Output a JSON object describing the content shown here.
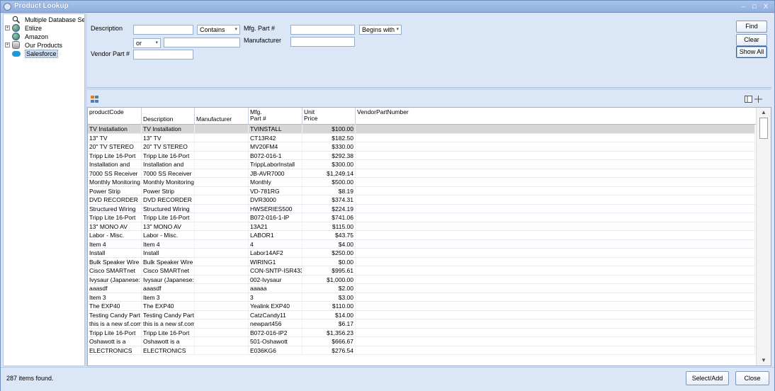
{
  "window": {
    "title": "Product Lookup",
    "minimize": "–",
    "maximize": "□",
    "close": "X"
  },
  "tree": {
    "items": [
      {
        "label": "Multiple Database Search",
        "expander": "",
        "icon": "search-icon",
        "selected": false
      },
      {
        "label": "Etilize",
        "expander": "+",
        "icon": "database-globe-icon",
        "selected": false
      },
      {
        "label": "Amazon",
        "expander": "",
        "icon": "database-globe-icon",
        "selected": false
      },
      {
        "label": "Our Products",
        "expander": "+",
        "icon": "database-icon",
        "selected": false
      },
      {
        "label": "Salesforce",
        "expander": "",
        "icon": "salesforce-cloud-icon",
        "selected": true
      }
    ]
  },
  "search": {
    "description_label": "Description",
    "description_value": "",
    "description_mode": "Contains",
    "logic_operator": "or",
    "description2_value": "",
    "mfg_part_label": "Mfg. Part #",
    "mfg_part_value": "",
    "mfg_part_mode": "Begins with",
    "manufacturer_label": "Manufacturer",
    "manufacturer_value": "",
    "vendor_part_label": "Vendor Part #",
    "vendor_part_value": "",
    "find_button": "Find",
    "clear_button": "Clear",
    "show_all_button": "Show All"
  },
  "grid": {
    "columns": {
      "productCode": "productCode",
      "description": "Description",
      "manufacturer": "Manufacturer",
      "mfg_part_1": "Mfg.",
      "mfg_part_2": "Part #",
      "unit_price_1": "Unit",
      "unit_price_2": "Price",
      "vendor": "VendorPartNumber"
    },
    "rows": [
      [
        "TV Installation",
        "TV Installation",
        "",
        "TVINSTALL",
        "$100.00",
        ""
      ],
      [
        "13\" TV",
        "13\" TV",
        "",
        "CT13R42",
        "$182.50",
        ""
      ],
      [
        "20\" TV STEREO",
        "20\" TV STEREO",
        "",
        "MV20FM4",
        "$330.00",
        ""
      ],
      [
        "Tripp Lite 16-Port",
        "Tripp Lite 16-Port",
        "",
        "B072-016-1",
        "$292.38",
        ""
      ],
      [
        "Installation and",
        "Installation and",
        "",
        "TrippLaborInstall",
        "$300.00",
        ""
      ],
      [
        "7000 SS Receiver",
        "7000 SS Receiver",
        "",
        "JB-AVR7000",
        "$1,249.14",
        ""
      ],
      [
        "Monthly Monitoring",
        "Monthly Monitoring",
        "",
        "Monthly",
        "$500.00",
        ""
      ],
      [
        "Power Strip",
        "Power Strip",
        "",
        "VD-781RG",
        "$8.19",
        ""
      ],
      [
        "DVD RECORDER",
        "DVD RECORDER",
        "",
        "DVR3000",
        "$374.31",
        ""
      ],
      [
        "Structured Wiring",
        "Structured Wiring",
        "",
        "HWSERIES500",
        "$224.19",
        ""
      ],
      [
        "Tripp Lite 16-Port",
        "Tripp Lite 16-Port",
        "",
        "B072-016-1-IP",
        "$741.06",
        ""
      ],
      [
        "13\" MONO AV",
        "13\" MONO AV",
        "",
        "13A21",
        "$115.00",
        ""
      ],
      [
        "Labor - Misc.",
        "Labor - Misc.",
        "",
        "LABOR1",
        "$43.75",
        ""
      ],
      [
        "Item 4",
        "Item 4",
        "",
        "4",
        "$4.00",
        ""
      ],
      [
        "Install",
        "Install",
        "",
        "Labor14AF2",
        "$250.00",
        ""
      ],
      [
        "Bulk Speaker Wire -",
        "Bulk Speaker Wire -",
        "",
        "WIRING1",
        "$0.00",
        ""
      ],
      [
        "Cisco SMARTnet",
        "Cisco SMARTnet",
        "",
        "CON-SNTP-ISR433",
        "$995.61",
        ""
      ],
      [
        "Ivysaur (Japanese:",
        "Ivysaur (Japanese:",
        "",
        "002-Ivysaur",
        "$1,000.00",
        ""
      ],
      [
        "aaasdf",
        "aaasdf",
        "",
        "aaaaa",
        "$2.00",
        ""
      ],
      [
        "Item 3",
        "Item 3",
        "",
        "3",
        "$3.00",
        ""
      ],
      [
        "The EXP40",
        "The EXP40",
        "",
        "Yealink EXP40",
        "$110.00",
        ""
      ],
      [
        "Testing Candy Part -",
        "Testing Candy Part -",
        "",
        "CatzCandy11",
        "$14.00",
        ""
      ],
      [
        "this is a new sf.com",
        "this is a new sf.com",
        "",
        "newpart456",
        "$6.17",
        ""
      ],
      [
        "Tripp Lite 16-Port",
        "Tripp Lite 16-Port",
        "",
        "B072-016-IP2",
        "$1,356.23",
        ""
      ],
      [
        "Oshawott is a",
        "Oshawott is a",
        "",
        "501-Oshawott",
        "$666.67",
        ""
      ],
      [
        "ELECTRONICS",
        "ELECTRONICS",
        "",
        "E036KG6",
        "$276.54",
        ""
      ]
    ]
  },
  "status": {
    "items_found": "287 items found.",
    "select_add_button": "Select/Add",
    "close_button": "Close"
  },
  "colors": {
    "accent": "#dbe7f7",
    "selected_row": "#d6d6d6",
    "title_bar": "#8eb0e0"
  }
}
